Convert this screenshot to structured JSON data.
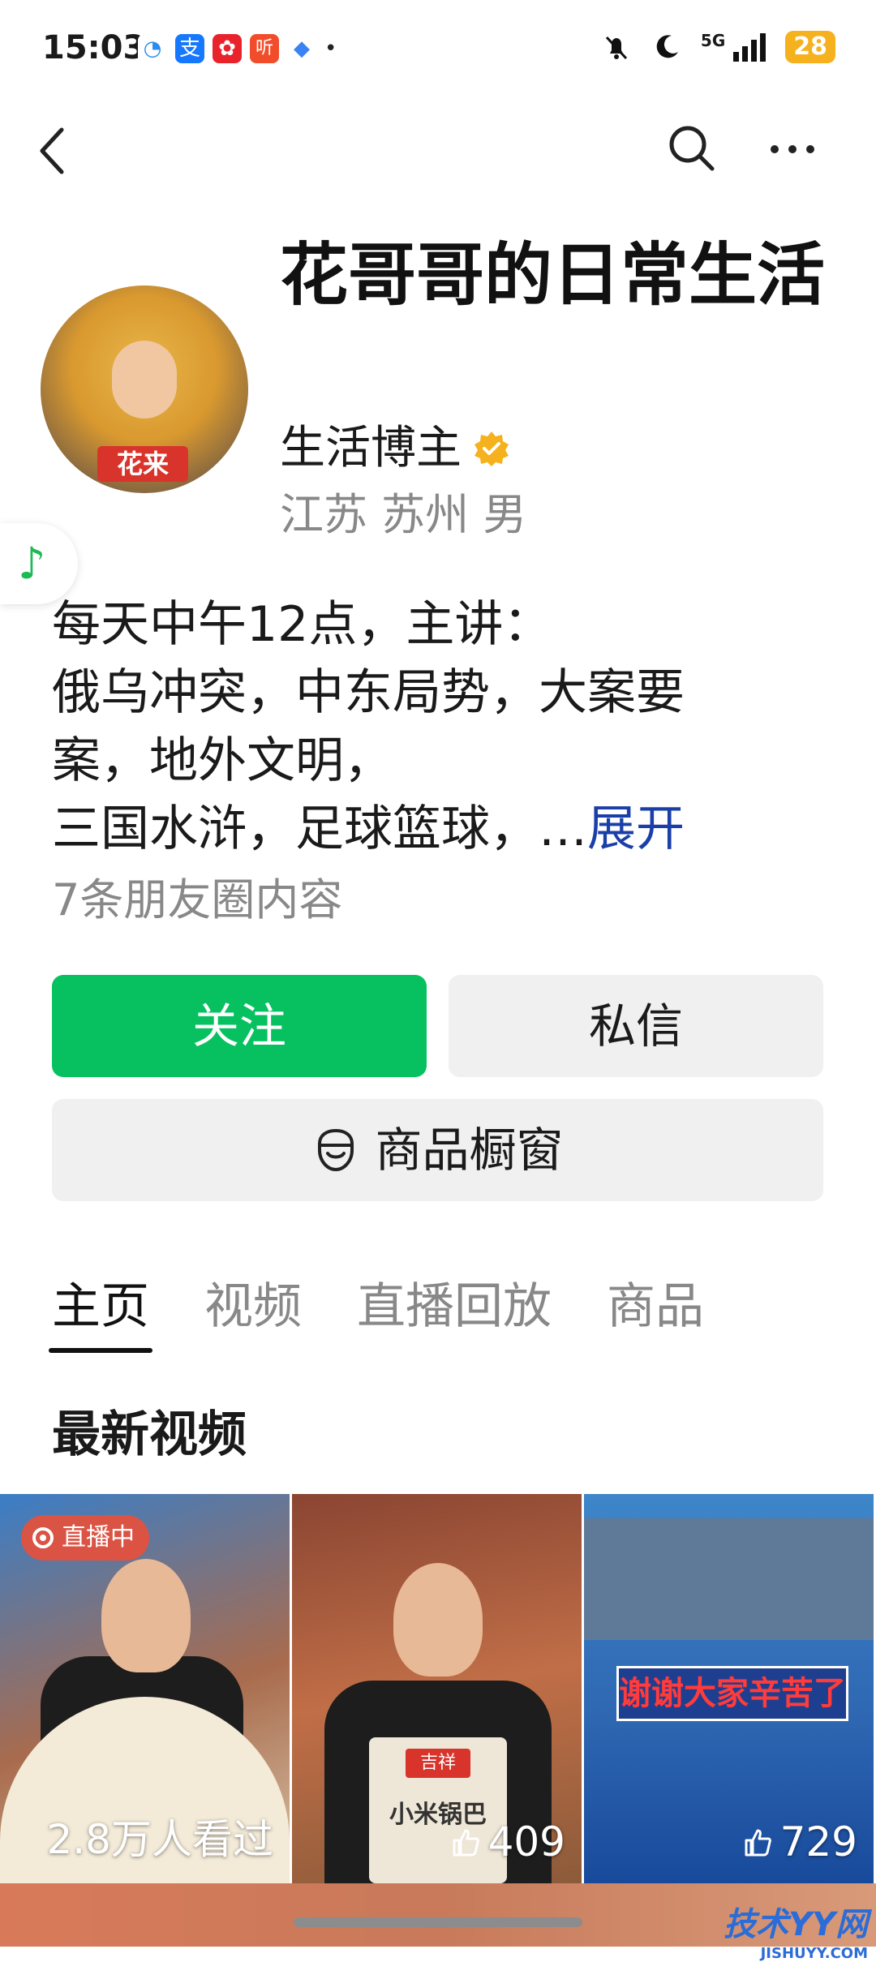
{
  "status_bar": {
    "time": "15:03",
    "network": "5G",
    "battery": "28",
    "notif_icons": [
      "qq-icon",
      "alipay-icon",
      "taobao-icon",
      "ting-icon",
      "browser-icon"
    ]
  },
  "profile": {
    "name": "花哥哥的日常生活",
    "role": "生活博主",
    "location": "江苏 苏州 男",
    "avatar_tag": "花来",
    "bio_lines": [
      "每天中午12点，主讲：",
      "俄乌冲突，中东局势，大案要",
      "案，地外文明，",
      "三国水浒，足球篮球，…"
    ],
    "expand_label": "展开",
    "moments_count": "7条朋友圈内容"
  },
  "actions": {
    "follow_label": "关注",
    "message_label": "私信",
    "shop_label": "商品橱窗"
  },
  "tabs": [
    {
      "label": "主页",
      "active": true
    },
    {
      "label": "视频",
      "active": false
    },
    {
      "label": "直播回放",
      "active": false
    },
    {
      "label": "商品",
      "active": false
    }
  ],
  "section": {
    "title": "最新视频"
  },
  "videos": [
    {
      "badge": "直播中",
      "count": "2.8万人看过",
      "banner": ""
    },
    {
      "badge": "",
      "count": "409",
      "bag_text": "小米锅巴",
      "brand": "吉祥"
    },
    {
      "badge": "",
      "count": "729",
      "banner": "谢谢大家辛苦了"
    }
  ],
  "watermark": {
    "main": "技术YY网",
    "sub": "JISHUYY.COM"
  },
  "colors": {
    "primary_green": "#07c160",
    "link_blue": "#1a3fa8",
    "secondary_gray": "#888888"
  }
}
